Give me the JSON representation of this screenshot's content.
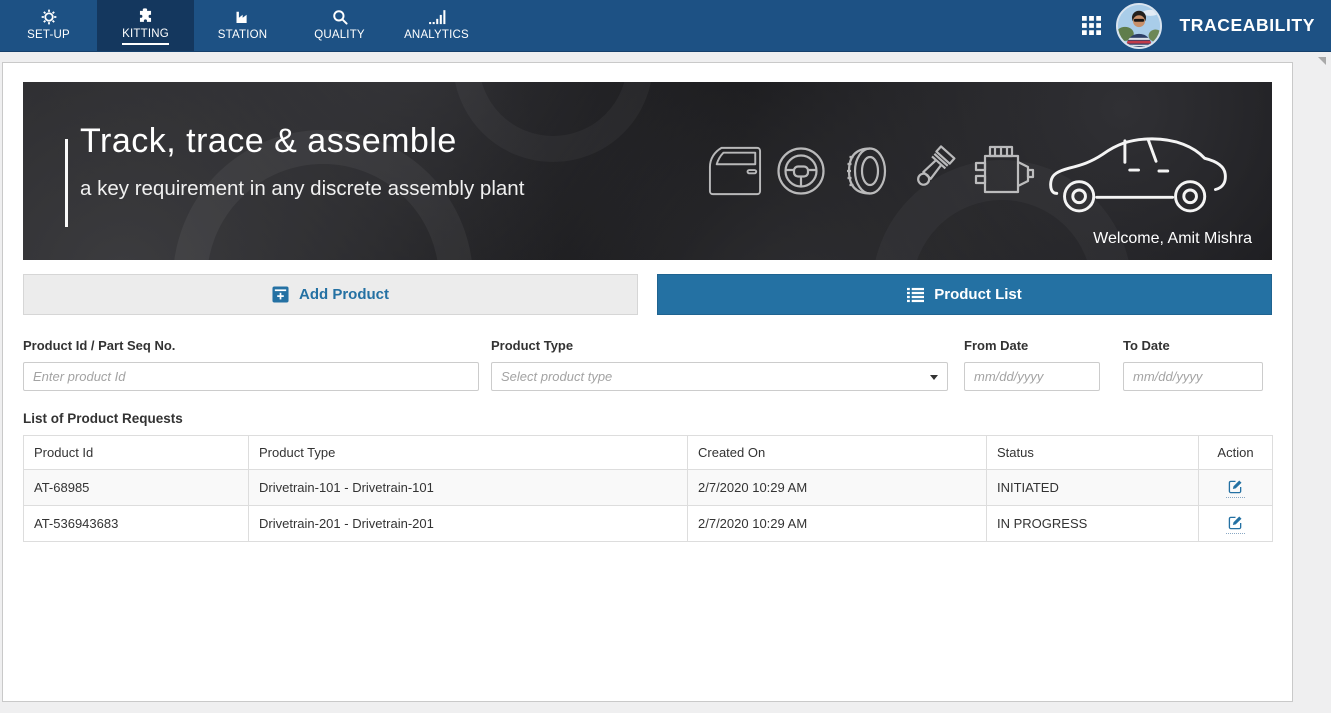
{
  "brand": {
    "title": "TRACEABILITY"
  },
  "navbar": {
    "tabs": [
      {
        "label": "SET-UP",
        "icon": "gear-icon",
        "active": false
      },
      {
        "label": "KITTING",
        "icon": "puzzle-icon",
        "active": true
      },
      {
        "label": "STATION",
        "icon": "factory-icon",
        "active": false
      },
      {
        "label": "QUALITY",
        "icon": "magnifier-icon",
        "active": false
      },
      {
        "label": "ANALYTICS",
        "icon": "bar-chart-icon",
        "active": false
      }
    ]
  },
  "banner": {
    "title": "Track, trace & assemble",
    "subtitle": "a key requirement in any discrete assembly plant",
    "welcome": "Welcome, Amit Mishra",
    "icons": [
      "car-door-icon",
      "steering-wheel-icon",
      "tire-icon",
      "piston-icon",
      "engine-icon",
      "car-icon"
    ]
  },
  "buttons": {
    "add_product": "Add Product",
    "product_list": "Product List"
  },
  "filters": {
    "product_id": {
      "label": "Product Id / Part Seq No.",
      "placeholder": "Enter product Id"
    },
    "product_type": {
      "label": "Product Type",
      "placeholder": "Select product type"
    },
    "from_date": {
      "label": "From Date",
      "placeholder": "mm/dd/yyyy"
    },
    "to_date": {
      "label": "To Date",
      "placeholder": "mm/dd/yyyy"
    }
  },
  "list": {
    "title": "List of Product Requests",
    "columns": [
      "Product Id",
      "Product Type",
      "Created On",
      "Status",
      "Action"
    ],
    "rows": [
      {
        "product_id": "AT-68985",
        "product_type": "Drivetrain-101 - Drivetrain-101",
        "created_on": "2/7/2020 10:29 AM",
        "status": "INITIATED"
      },
      {
        "product_id": "AT-536943683",
        "product_type": "Drivetrain-201 - Drivetrain-201",
        "created_on": "2/7/2020 10:29 AM",
        "status": "IN PROGRESS"
      }
    ],
    "action_icon": "edit-icon"
  },
  "header_icons": [
    "apps-grid-icon",
    "avatar"
  ],
  "colors": {
    "navbar": "#1d5184",
    "navbar_active": "#14375e",
    "accent_blue": "#2471a3",
    "page_bg": "#efeff0",
    "card_bg": "#ffffff",
    "banner_bg": "#111113",
    "table_stripe": "#f9f9f9",
    "border": "#dddddd"
  }
}
